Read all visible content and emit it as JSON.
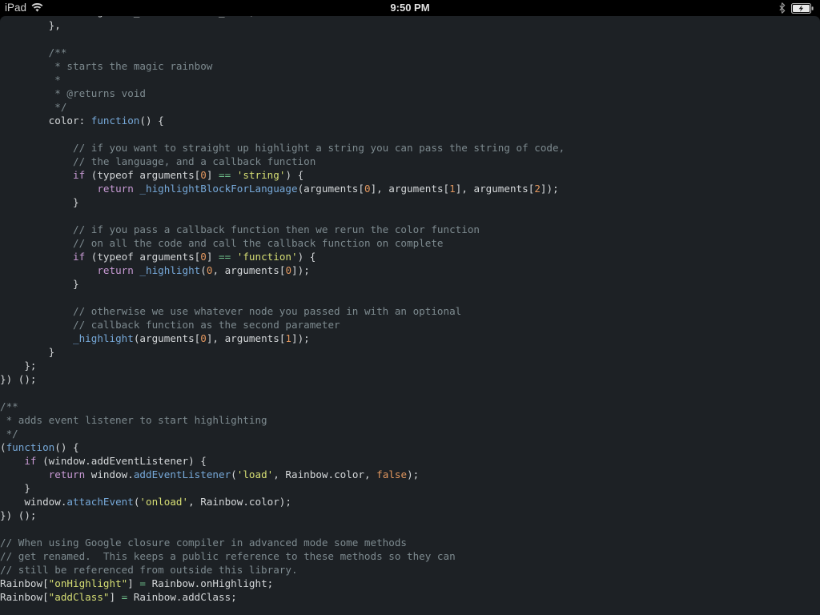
{
  "statusbar": {
    "device_label": "iPad",
    "wifi_icon": "wifi-icon",
    "time": "9:50 PM",
    "bluetooth_icon": "bluetooth-icon",
    "battery_icon": "battery-charging-icon"
  },
  "editor": {
    "background_color": "#1d2125",
    "foreground_color": "#d4d7d9",
    "comment_color": "#7d8a8f",
    "keyword_color": "#c89ad4",
    "function_color": "#76a8d8",
    "string_color": "#d6de74",
    "number_color": "#e0965e",
    "operator_color": "#6ebf8b",
    "font_size_px": 12.6,
    "line_height_px": 17
  },
  "code": {
    "language": "javascript",
    "lines": [
      [
        {
          "t": "plain",
          "s": "                "
        },
        {
          "t": "plain",
          "s": "global_class "
        },
        {
          "t": "operator",
          "s": "="
        },
        {
          "t": "plain",
          "s": " class_name;"
        }
      ],
      [
        {
          "t": "plain",
          "s": "        },"
        }
      ],
      [
        {
          "t": "plain",
          "s": ""
        }
      ],
      [
        {
          "t": "plain",
          "s": "        "
        },
        {
          "t": "comment",
          "s": "/**"
        }
      ],
      [
        {
          "t": "plain",
          "s": "        "
        },
        {
          "t": "comment",
          "s": " * starts the magic rainbow"
        }
      ],
      [
        {
          "t": "plain",
          "s": "        "
        },
        {
          "t": "comment",
          "s": " *"
        }
      ],
      [
        {
          "t": "plain",
          "s": "        "
        },
        {
          "t": "comment",
          "s": " * @returns void"
        }
      ],
      [
        {
          "t": "plain",
          "s": "        "
        },
        {
          "t": "comment",
          "s": " */"
        }
      ],
      [
        {
          "t": "plain",
          "s": "        color: "
        },
        {
          "t": "function",
          "s": "function"
        },
        {
          "t": "plain",
          "s": "() {"
        }
      ],
      [
        {
          "t": "plain",
          "s": ""
        }
      ],
      [
        {
          "t": "plain",
          "s": "            "
        },
        {
          "t": "comment",
          "s": "// if you want to straight up highlight a string you can pass the string of code,"
        }
      ],
      [
        {
          "t": "plain",
          "s": "            "
        },
        {
          "t": "comment",
          "s": "// the language, and a callback function"
        }
      ],
      [
        {
          "t": "plain",
          "s": "            "
        },
        {
          "t": "keyword",
          "s": "if"
        },
        {
          "t": "plain",
          "s": " (typeof arguments["
        },
        {
          "t": "number",
          "s": "0"
        },
        {
          "t": "plain",
          "s": "] "
        },
        {
          "t": "operator",
          "s": "=="
        },
        {
          "t": "plain",
          "s": " "
        },
        {
          "t": "string",
          "s": "'string'"
        },
        {
          "t": "plain",
          "s": ") {"
        }
      ],
      [
        {
          "t": "plain",
          "s": "                "
        },
        {
          "t": "keyword",
          "s": "return"
        },
        {
          "t": "plain",
          "s": " "
        },
        {
          "t": "function",
          "s": "_highlightBlockForLanguage"
        },
        {
          "t": "plain",
          "s": "(arguments["
        },
        {
          "t": "number",
          "s": "0"
        },
        {
          "t": "plain",
          "s": "], arguments["
        },
        {
          "t": "number",
          "s": "1"
        },
        {
          "t": "plain",
          "s": "], arguments["
        },
        {
          "t": "number",
          "s": "2"
        },
        {
          "t": "plain",
          "s": "]);"
        }
      ],
      [
        {
          "t": "plain",
          "s": "            }"
        }
      ],
      [
        {
          "t": "plain",
          "s": ""
        }
      ],
      [
        {
          "t": "plain",
          "s": "            "
        },
        {
          "t": "comment",
          "s": "// if you pass a callback function then we rerun the color function"
        }
      ],
      [
        {
          "t": "plain",
          "s": "            "
        },
        {
          "t": "comment",
          "s": "// on all the code and call the callback function on complete"
        }
      ],
      [
        {
          "t": "plain",
          "s": "            "
        },
        {
          "t": "keyword",
          "s": "if"
        },
        {
          "t": "plain",
          "s": " (typeof arguments["
        },
        {
          "t": "number",
          "s": "0"
        },
        {
          "t": "plain",
          "s": "] "
        },
        {
          "t": "operator",
          "s": "=="
        },
        {
          "t": "plain",
          "s": " "
        },
        {
          "t": "string",
          "s": "'function'"
        },
        {
          "t": "plain",
          "s": ") {"
        }
      ],
      [
        {
          "t": "plain",
          "s": "                "
        },
        {
          "t": "keyword",
          "s": "return"
        },
        {
          "t": "plain",
          "s": " "
        },
        {
          "t": "function",
          "s": "_highlight"
        },
        {
          "t": "plain",
          "s": "("
        },
        {
          "t": "number",
          "s": "0"
        },
        {
          "t": "plain",
          "s": ", arguments["
        },
        {
          "t": "number",
          "s": "0"
        },
        {
          "t": "plain",
          "s": "]);"
        }
      ],
      [
        {
          "t": "plain",
          "s": "            }"
        }
      ],
      [
        {
          "t": "plain",
          "s": ""
        }
      ],
      [
        {
          "t": "plain",
          "s": "            "
        },
        {
          "t": "comment",
          "s": "// otherwise we use whatever node you passed in with an optional"
        }
      ],
      [
        {
          "t": "plain",
          "s": "            "
        },
        {
          "t": "comment",
          "s": "// callback function as the second parameter"
        }
      ],
      [
        {
          "t": "plain",
          "s": "            "
        },
        {
          "t": "function",
          "s": "_highlight"
        },
        {
          "t": "plain",
          "s": "(arguments["
        },
        {
          "t": "number",
          "s": "0"
        },
        {
          "t": "plain",
          "s": "], arguments["
        },
        {
          "t": "number",
          "s": "1"
        },
        {
          "t": "plain",
          "s": "]);"
        }
      ],
      [
        {
          "t": "plain",
          "s": "        }"
        }
      ],
      [
        {
          "t": "plain",
          "s": "    };"
        }
      ],
      [
        {
          "t": "plain",
          "s": "}) ();"
        }
      ],
      [
        {
          "t": "plain",
          "s": ""
        }
      ],
      [
        {
          "t": "comment",
          "s": "/**"
        }
      ],
      [
        {
          "t": "comment",
          "s": " * adds event listener to start highlighting"
        }
      ],
      [
        {
          "t": "comment",
          "s": " */"
        }
      ],
      [
        {
          "t": "plain",
          "s": "("
        },
        {
          "t": "function",
          "s": "function"
        },
        {
          "t": "plain",
          "s": "() {"
        }
      ],
      [
        {
          "t": "plain",
          "s": "    "
        },
        {
          "t": "keyword",
          "s": "if"
        },
        {
          "t": "plain",
          "s": " (window.addEventListener) {"
        }
      ],
      [
        {
          "t": "plain",
          "s": "        "
        },
        {
          "t": "keyword",
          "s": "return"
        },
        {
          "t": "plain",
          "s": " window."
        },
        {
          "t": "function",
          "s": "addEventListener"
        },
        {
          "t": "plain",
          "s": "("
        },
        {
          "t": "string",
          "s": "'load'"
        },
        {
          "t": "plain",
          "s": ", Rainbow.color, "
        },
        {
          "t": "constant",
          "s": "false"
        },
        {
          "t": "plain",
          "s": ");"
        }
      ],
      [
        {
          "t": "plain",
          "s": "    }"
        }
      ],
      [
        {
          "t": "plain",
          "s": "    window."
        },
        {
          "t": "function",
          "s": "attachEvent"
        },
        {
          "t": "plain",
          "s": "("
        },
        {
          "t": "string",
          "s": "'onload'"
        },
        {
          "t": "plain",
          "s": ", Rainbow.color);"
        }
      ],
      [
        {
          "t": "plain",
          "s": "}) ();"
        }
      ],
      [
        {
          "t": "plain",
          "s": ""
        }
      ],
      [
        {
          "t": "comment",
          "s": "// When using Google closure compiler in advanced mode some methods"
        }
      ],
      [
        {
          "t": "comment",
          "s": "// get renamed.  This keeps a public reference to these methods so they can"
        }
      ],
      [
        {
          "t": "comment",
          "s": "// still be referenced from outside this library."
        }
      ],
      [
        {
          "t": "plain",
          "s": "Rainbow["
        },
        {
          "t": "string",
          "s": "\"onHighlight\""
        },
        {
          "t": "plain",
          "s": "] "
        },
        {
          "t": "operator",
          "s": "="
        },
        {
          "t": "plain",
          "s": " Rainbow.onHighlight;"
        }
      ],
      [
        {
          "t": "plain",
          "s": "Rainbow["
        },
        {
          "t": "string",
          "s": "\"addClass\""
        },
        {
          "t": "plain",
          "s": "] "
        },
        {
          "t": "operator",
          "s": "="
        },
        {
          "t": "plain",
          "s": " Rainbow.addClass;"
        }
      ]
    ]
  }
}
